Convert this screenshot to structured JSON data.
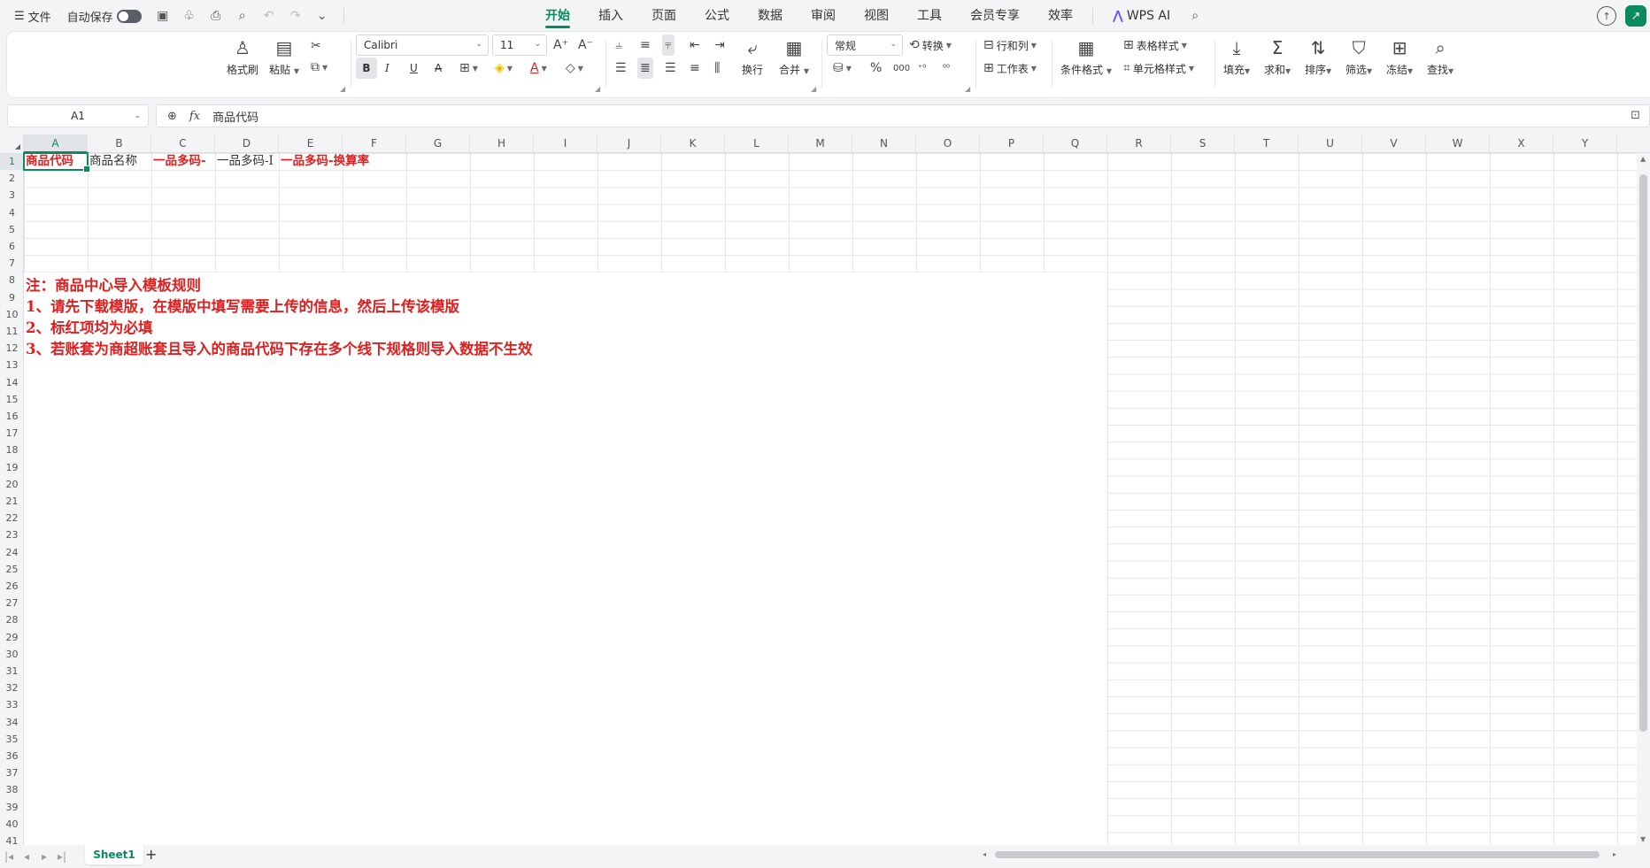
{
  "menubar": {
    "file_label": "文件",
    "autosave_label": "自动保存",
    "tabs": [
      {
        "label": "开始",
        "active": true
      },
      {
        "label": "插入"
      },
      {
        "label": "页面"
      },
      {
        "label": "公式"
      },
      {
        "label": "数据"
      },
      {
        "label": "审阅"
      },
      {
        "label": "视图"
      },
      {
        "label": "工具"
      },
      {
        "label": "会员专享"
      },
      {
        "label": "效率"
      }
    ],
    "wps_ai_label": "WPS AI",
    "accent_color": "#0b8a5f"
  },
  "ribbon": {
    "format_painter": "格式刷",
    "paste": "粘贴",
    "font_name": "Calibri",
    "font_size": "11",
    "bold": "B",
    "italic": "I",
    "underline": "U",
    "strike": "A",
    "wrap": "换行",
    "merge": "合并",
    "number_format": "常规",
    "convert": "转换",
    "row_col": "行和列",
    "worksheet": "工作表",
    "cond_format": "条件格式",
    "table_style": "表格样式",
    "cell_style": "单元格样式",
    "fill": "填充",
    "sum": "求和",
    "sort": "排序",
    "filter": "筛选",
    "freeze": "冻结",
    "find": "查找"
  },
  "formula_bar": {
    "name_box": "A1",
    "fx": "fx",
    "value": "商品代码"
  },
  "columns": [
    "A",
    "B",
    "C",
    "D",
    "E",
    "F",
    "G",
    "H",
    "I",
    "J",
    "K",
    "L",
    "M",
    "N",
    "O",
    "P",
    "Q",
    "R",
    "S",
    "T",
    "U",
    "V",
    "W",
    "X",
    "Y"
  ],
  "rows": [
    "1",
    "2",
    "3",
    "4",
    "5",
    "6",
    "7",
    "8",
    "9",
    "10",
    "11",
    "12",
    "13",
    "14",
    "15",
    "16",
    "17",
    "18",
    "19",
    "20",
    "21",
    "22",
    "23",
    "24",
    "25",
    "26",
    "27",
    "28",
    "29",
    "30",
    "31",
    "32",
    "33",
    "34",
    "35",
    "36",
    "37",
    "38",
    "39",
    "40",
    "41"
  ],
  "cells": {
    "A1": "商品代码",
    "B1": "商品名称",
    "C1": "一品多码-",
    "D1": "一品多码-I",
    "E1": "一品多码-换算率"
  },
  "notes": [
    "注：商品中心导入模板规则",
    "1、请先下载模版，在模版中填写需要上传的信息，然后上传该模版",
    "2、标红项均为必填",
    "3、若账套为商超账套且导入的商品代码下存在多个线下规格则导入数据不生效"
  ],
  "sheets": [
    {
      "label": "Sheet1",
      "active": true
    }
  ],
  "colors": {
    "red_text": "#e02020",
    "accent": "#0b8a5f"
  }
}
